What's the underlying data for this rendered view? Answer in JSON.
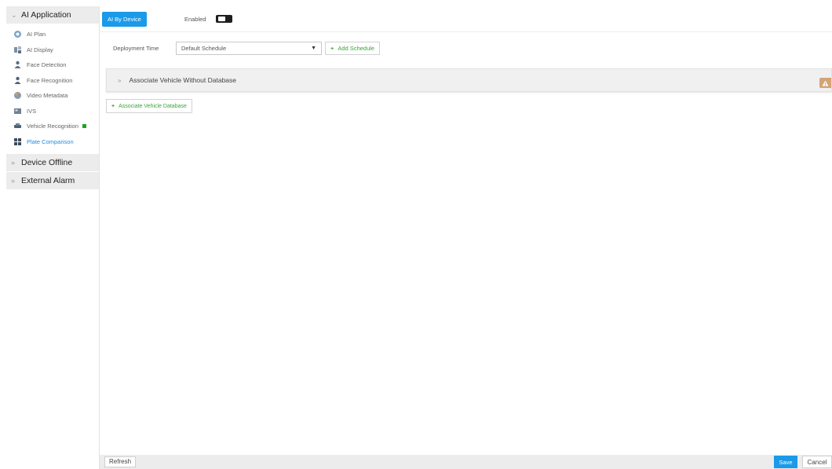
{
  "sidebar": {
    "ai_application": {
      "label": "AI Application",
      "items": [
        {
          "label": "AI Plan",
          "icon": "ai-plan-icon"
        },
        {
          "label": "AI Display",
          "icon": "ai-display-icon"
        },
        {
          "label": "Face Detection",
          "icon": "face-detection-icon"
        },
        {
          "label": "Face Recognition",
          "icon": "face-recognition-icon"
        },
        {
          "label": "Video Metadata",
          "icon": "video-metadata-icon"
        },
        {
          "label": "IVS",
          "icon": "ivs-icon"
        },
        {
          "label": "Vehicle Recognition",
          "icon": "vehicle-recognition-icon"
        },
        {
          "label": "Plate Comparison",
          "icon": "plate-comparison-icon",
          "active": true
        }
      ]
    },
    "device_offline": {
      "label": "Device Offline"
    },
    "external_alarm": {
      "label": "External Alarm"
    }
  },
  "topbar": {
    "mode_button": "AI By Device",
    "enabled_label": "Enabled",
    "enabled": true
  },
  "deployment": {
    "label": "Deployment Time",
    "schedule_value": "Default Schedule",
    "add_schedule": "Add Schedule"
  },
  "associate_panel": {
    "label": "Associate Vehicle Without Database"
  },
  "add_database": "Associate Vehicle Database",
  "footer": {
    "refresh": "Refresh",
    "save": "Save",
    "cancel": "Cancel"
  },
  "colors": {
    "accent": "#1a9ae8",
    "add_green": "#3aa53a",
    "active_text": "#1d8ce0",
    "warning": "#d3a476"
  }
}
